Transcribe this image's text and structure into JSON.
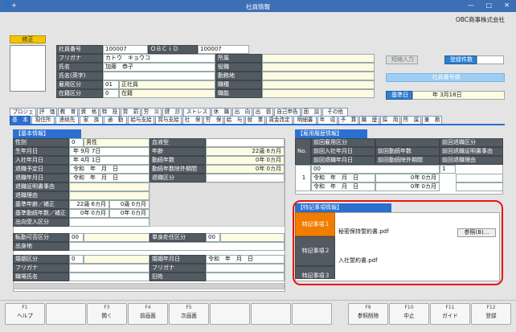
{
  "window": {
    "title": "社員情報",
    "app_icon": "person-plus-icon",
    "btn_min": "—",
    "btn_max": "□",
    "btn_close": "✕"
  },
  "company": "OBC商事株式会社",
  "edit_button": "修正",
  "employee": {
    "lbl_no": "社員番号",
    "no": "100007",
    "lbl_obcid": "ＯＢＣｉＤ",
    "obcid": "100007",
    "lbl_kana": "フリガナ",
    "kana": "カトウ　キョウコ",
    "lbl_name": "氏名",
    "name": "加藤　恭子",
    "lbl_eng": "氏名(英字)",
    "eng": "",
    "lbl_kubun": "雇用区分",
    "kubun_code": "01",
    "kubun": "正社員",
    "lbl_zaiseki": "在籍区分",
    "zaiseki_code": "0",
    "zaiseki": "在籍",
    "lbl_shozoku": "所属",
    "lbl_yakushoku": "役職",
    "lbl_kinmuchi": "勤務地",
    "lbl_shokushu": "職種",
    "lbl_shokuno": "職能"
  },
  "right_top": {
    "short_input": "短縮入力",
    "reg_count": "登録件数",
    "emp_no_label": "社員番号順",
    "base_date_label": "基準日",
    "base_date": "年  3月18日"
  },
  "tabs_row1": [
    "プロジェ",
    "評　価",
    "教　育",
    "資　格",
    "特　技",
    "賞　罰",
    "労　災",
    "健　診",
    "ストレス",
    "休　職",
    "出　向",
    "出　張",
    "自己申告",
    "面　談",
    "その他"
  ],
  "tabs_row2": [
    "基　本",
    "現住所",
    "連絡先",
    "家　族",
    "通　勤",
    "給与支給",
    "賞与支給",
    "社　保",
    "労　保",
    "給　与",
    "就　業",
    "賃金改定",
    "明細書",
    "年　収",
    "予　算",
    "職　歴",
    "採　用",
    "所　属",
    "兼　務"
  ],
  "basic": {
    "header": "【基本情報】",
    "rows": [
      {
        "label": "性別",
        "code": "0",
        "value": "男性"
      },
      {
        "label": "生年月日",
        "value": "年  9月  7日"
      },
      {
        "label": "入社年月日",
        "value": "年  4月  1日"
      },
      {
        "label": "退職予定日",
        "value": "令和　年　月　日"
      },
      {
        "label": "退職年月日",
        "value": "令和　年　月　日"
      },
      {
        "label": "退職証明書事由",
        "value": ""
      },
      {
        "label": "退職理由",
        "value": ""
      },
      {
        "label": "基準年齢／補正",
        "value": "22歳  6カ月",
        "value2": "0歳  0カ月"
      },
      {
        "label": "基準勤続年数／補正",
        "value": "0年  0カ月",
        "value2": "0年  0カ月"
      },
      {
        "label": "出向受入区分",
        "value": ""
      }
    ],
    "right_rows": [
      {
        "label": "血液型",
        "value": ""
      },
      {
        "label": "年齢",
        "value": "22歳  6カ月"
      },
      {
        "label": "勤続年数",
        "value": "0年  0カ月"
      },
      {
        "label": "勤続年数除外期間",
        "value": "0年  0カ月"
      },
      {
        "label": "退職区分",
        "value": ""
      }
    ],
    "transfer_label": "転勤可否区分",
    "transfer_code": "00",
    "tanshin_label": "単身赴任区分",
    "tanshin_code": "00",
    "birthplace_label": "出身地",
    "birthplace": "",
    "spouse_label": "婚姻区分",
    "spouse_code": "0",
    "marriage_date_label": "婚姻年月日",
    "marriage_date": "令和　年　月　日",
    "furigana_label": "フリガナ",
    "furigana2_label": "フリガナ",
    "oldname_label": "職場氏名",
    "kyusei_label": "旧姓"
  },
  "employment_history": {
    "header": "【雇用履歴情報】",
    "no_label": "No.",
    "cols": [
      "前回雇用区分",
      "前回入社年月日",
      "前回退職年月日"
    ],
    "cols2": [
      "前回勤続年数",
      "前回勤続除外期間"
    ],
    "cols3": [
      "前回退職区分",
      "前回退職証明書事由",
      "前回退職理由"
    ],
    "row_no": "1",
    "code": "00",
    "date1": "令和　年　月　日",
    "date2": "令和　年　月　日",
    "yrs1": "0年  0カ月",
    "yrs2": "0年  0カ月"
  },
  "special": {
    "header": "【特記事項情報】",
    "items": [
      {
        "label": "特記事項１",
        "value": "秘密保持誓約書.pdf",
        "button": "参照(B)..."
      },
      {
        "label": "特記事項２",
        "value": "入社誓約書.pdf"
      },
      {
        "label": "特記事項３",
        "value": ""
      }
    ]
  },
  "fkeys": [
    {
      "key": "F1",
      "label": "ヘルプ"
    },
    {
      "key": "",
      "label": ""
    },
    {
      "key": "F3",
      "label": "開く"
    },
    {
      "key": "F4",
      "label": "前画面"
    },
    {
      "key": "F5",
      "label": "次画面"
    },
    {
      "key": "",
      "label": ""
    },
    {
      "key": "",
      "label": ""
    },
    {
      "key": "",
      "label": ""
    },
    {
      "key": "F9",
      "label": "参照削除"
    },
    {
      "key": "F10",
      "label": "中止"
    },
    {
      "key": "F11",
      "label": "ガイド"
    },
    {
      "key": "F12",
      "label": "登録"
    }
  ]
}
